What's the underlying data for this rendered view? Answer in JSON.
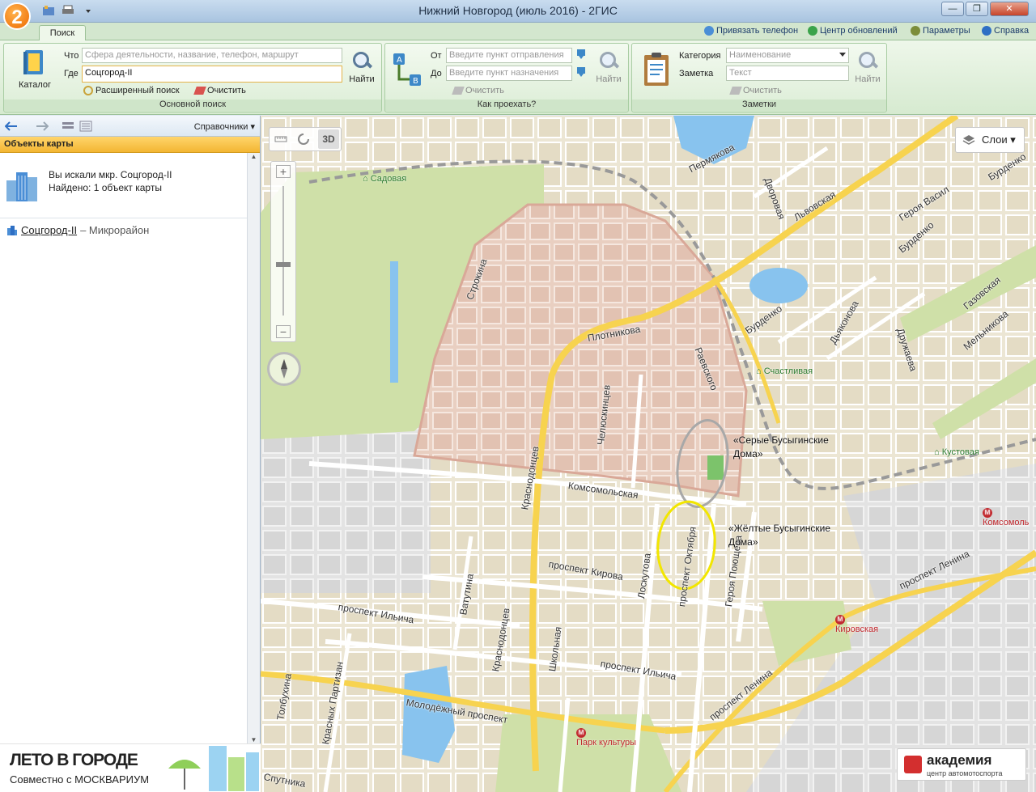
{
  "window": {
    "title": "Нижний Новгород (июль 2016) - 2ГИС",
    "app_logo_text": "2"
  },
  "ribbon": {
    "tab_search": "Поиск",
    "top_links": [
      "Привязать телефон",
      "Центр обновлений",
      "Параметры",
      "Справка"
    ],
    "main_search": {
      "catalog_label": "Каталог",
      "what_label": "Что",
      "what_placeholder": "Сфера деятельности, название, телефон, маршрут",
      "where_label": "Где",
      "where_value": "Соцгород-II",
      "find_label": "Найти",
      "advanced_label": "Расширенный поиск",
      "clear_label": "Очистить",
      "group_title": "Основной поиск"
    },
    "route": {
      "from_label": "От",
      "from_placeholder": "Введите пункт отправления",
      "to_label": "До",
      "to_placeholder": "Введите пункт назначения",
      "clear_label": "Очистить",
      "find_label": "Найти",
      "group_title": "Как проехать?"
    },
    "notes": {
      "category_label": "Категория",
      "category_placeholder": "Наименование",
      "note_label": "Заметка",
      "note_placeholder": "Текст",
      "clear_label": "Очистить",
      "find_label": "Найти",
      "group_title": "Заметки"
    }
  },
  "left_panel": {
    "directories_label": "Справочники",
    "header": "Объекты карты",
    "searched_text": "Вы искали мкр. Соцгород-II",
    "found_text": "Найдено: 1 объект карты",
    "result": {
      "name": "Соцгород-II",
      "type": " – Микрорайон"
    },
    "promo": {
      "title": "ЛЕТО В ГОРОДЕ",
      "subtitle": "Совместно с МОСКВАРИУМ"
    }
  },
  "map": {
    "toolbar_3d": "3D",
    "layers_label": "Слои",
    "streets": [
      "Пермякова",
      "Дворовая",
      "Героя Васил",
      "Бурденко",
      "Львовская",
      "Бурденко",
      "Строкина",
      "Плотникова",
      "Раевского",
      "Бурденко",
      "Дьяконова",
      "Дружаева",
      "Газовская",
      "Мельникова",
      "Челюскинцев",
      "Краснодонцев",
      "Комсомольская",
      "проспект Кирова",
      "Лоскутова",
      "проспект Октября",
      "Героя Поющева",
      "проспект Ленина",
      "Ватутина",
      "проспект Ильича",
      "Школьная",
      "Краснодонцев",
      "проспект Ильича",
      "Молодёжный проспект",
      "Толбухина",
      "Красных Партизан",
      "проспект Ленина",
      "Спутника"
    ],
    "stops": [
      "Садовая",
      "Счастливая",
      "Кустовая"
    ],
    "metro": [
      "Комсомоль",
      "Кировская",
      "Парк культуры"
    ],
    "annotation_grey": "«Серые Бусыгинские Дома»",
    "annotation_yellow": "«Жёлтые Бусыгинские Дома»",
    "ad": {
      "name": "академия",
      "tagline": "центр автомотоспорта"
    }
  },
  "colors": {
    "district_fill": "#e7c9b9",
    "road_major": "#f7d34f",
    "park": "#cfe0a8",
    "water": "#88c3ee",
    "annotation_grey": "#a8a8a8",
    "annotation_yellow": "#f2e600"
  }
}
